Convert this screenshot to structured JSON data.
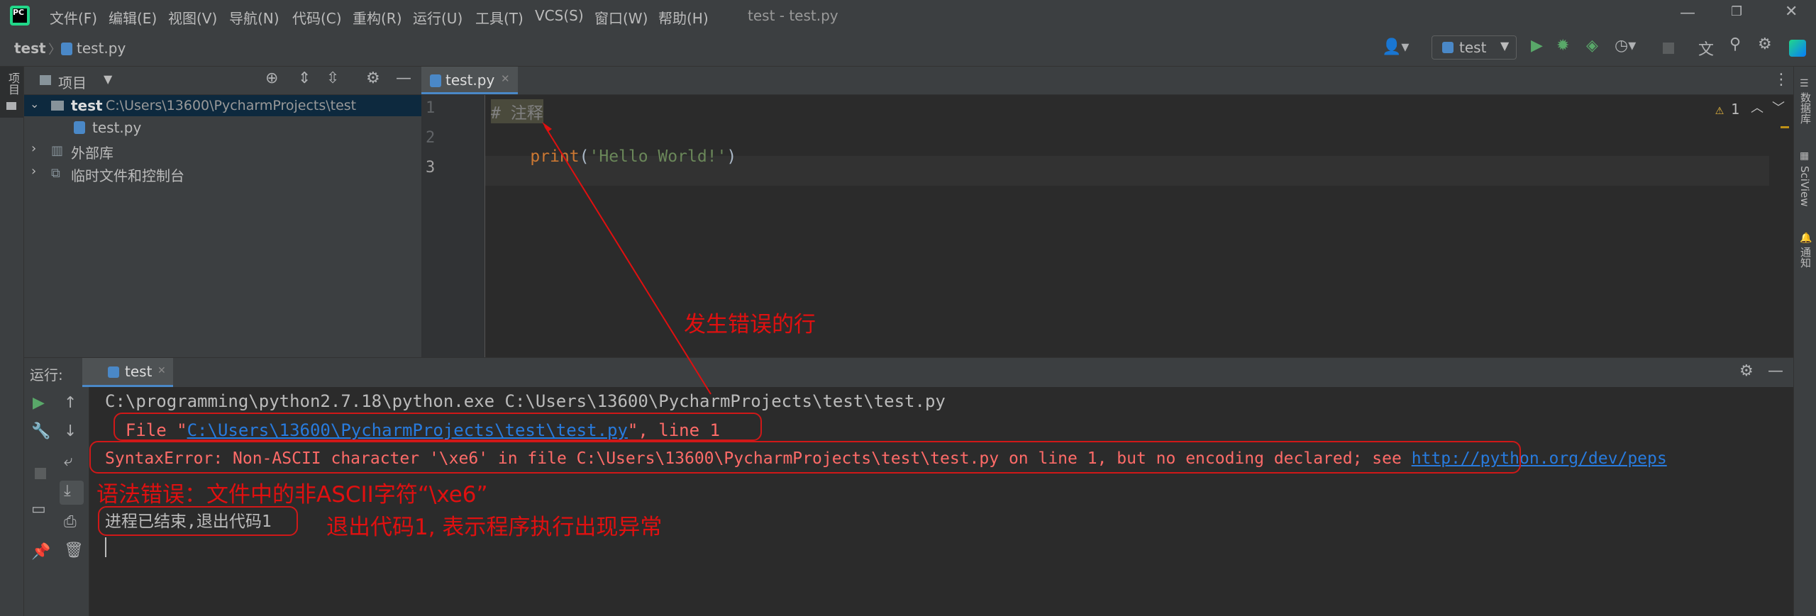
{
  "window": {
    "title": "test - test.py",
    "menu": [
      "文件(F)",
      "编辑(E)",
      "视图(V)",
      "导航(N)",
      "代码(C)",
      "重构(R)",
      "运行(U)",
      "工具(T)",
      "VCS(S)",
      "窗口(W)",
      "帮助(H)"
    ]
  },
  "breadcrumb": {
    "project": "test",
    "file": "test.py"
  },
  "toolbar": {
    "run_config": "test"
  },
  "left_strip": {
    "project_label": "项目"
  },
  "right_strip": {
    "database": "数据库",
    "sciview": "SciView",
    "notifications": "通知"
  },
  "project_panel": {
    "title": "项目",
    "tree": {
      "root_name": "test",
      "root_path": "C:\\Users\\13600\\PycharmProjects\\test",
      "file": "test.py",
      "external_libs": "外部库",
      "scratches": "临时文件和控制台"
    }
  },
  "editor": {
    "tab": "test.py",
    "lines": [
      "1",
      "2",
      "3"
    ],
    "code_comment": "# 注释",
    "code_print_fn": "print",
    "code_print_open": "(",
    "code_print_str": "'Hello World!'",
    "code_print_close": ")",
    "warnings_count": "1"
  },
  "run_panel": {
    "label": "运行:",
    "tab": "test",
    "console": {
      "command": "C:\\programming\\python2.7.18\\python.exe C:\\Users\\13600\\PycharmProjects\\test\\test.py",
      "file_prefix": "  File \"",
      "file_link": "C:\\Users\\13600\\PycharmProjects\\test\\test.py",
      "file_suffix": "\", line 1",
      "syntax_error": "SyntaxError: Non-ASCII character '\\xe6' in file C:\\Users\\13600\\PycharmProjects\\test\\test.py on line 1, but no encoding declared; see ",
      "pep_link": "http://python.org/dev/peps",
      "exit_line": "进程已结束,退出代码1"
    }
  },
  "annotations": {
    "error_line": "发生错误的行",
    "syntax_error_explain": "语法错误：文件中的非ASCII字符“\\xe6”",
    "exit_code_explain": "退出代码1, 表示程序执行出现异常"
  },
  "colors": {
    "annotation_red": "#e01010",
    "keyword_orange": "#cc7832",
    "string_green": "#6a8759",
    "comment_gray": "#808080",
    "link_blue": "#287bde",
    "error_red": "#ff6b68"
  }
}
